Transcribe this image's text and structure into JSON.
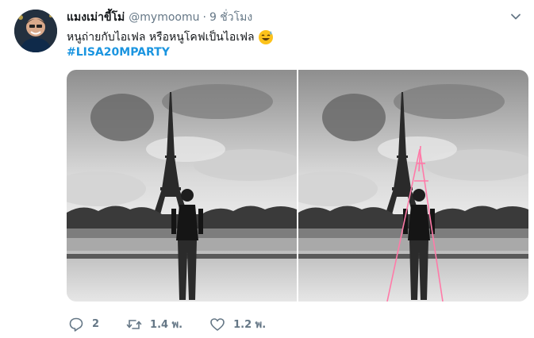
{
  "tweet": {
    "display_name": "แมงเม่าขี้โม่",
    "handle": "@mymoomu",
    "separator": "·",
    "time": "9 ชั่วโมง",
    "text": "หนูถ่ายกับไอเฟล หรือหนูโคฟเป็นไอเฟล",
    "emoji": "sweat-smile-emoji",
    "hashtag": "#LISA20MPARTY"
  },
  "actions": {
    "reply_count": "2",
    "retweet_count": "1.4 พ.",
    "like_count": "1.2 พ."
  },
  "icons": {
    "reply": "reply-icon",
    "retweet": "retweet-icon",
    "like": "heart-icon",
    "menu": "chevron-down-icon"
  },
  "colors": {
    "link": "#1b95e0",
    "muted": "#657786",
    "text": "#14171a",
    "annotation": "#ff7aa8"
  }
}
